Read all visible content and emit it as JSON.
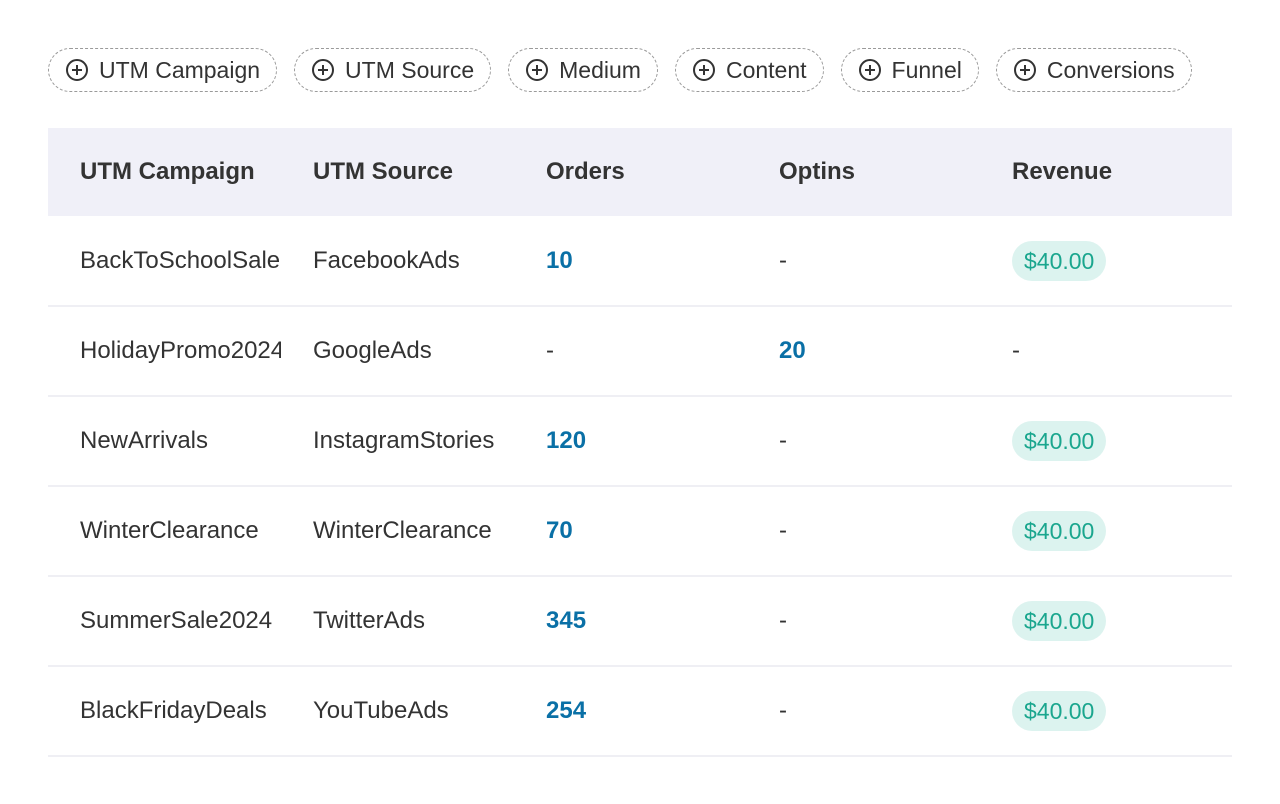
{
  "filters": [
    {
      "label": "UTM Campaign",
      "icon": "plus-circle-icon"
    },
    {
      "label": "UTM Source",
      "icon": "plus-circle-icon"
    },
    {
      "label": "Medium",
      "icon": "plus-circle-icon"
    },
    {
      "label": "Content",
      "icon": "plus-circle-icon"
    },
    {
      "label": "Funnel",
      "icon": "plus-circle-icon"
    },
    {
      "label": "Conversions",
      "icon": "plus-circle-icon"
    }
  ],
  "table": {
    "headers": [
      "UTM Campaign",
      "UTM Source",
      "Orders",
      "Optins",
      "Revenue"
    ],
    "rows": [
      {
        "campaign": "BackToSchoolSale",
        "source": "FacebookAds",
        "orders": "10",
        "optins": "-",
        "revenue": "$40.00"
      },
      {
        "campaign": "HolidayPromo2024",
        "source": "GoogleAds",
        "orders": "-",
        "optins": "20",
        "revenue": "-"
      },
      {
        "campaign": "NewArrivals",
        "source": "InstagramStories",
        "orders": "120",
        "optins": "-",
        "revenue": "$40.00"
      },
      {
        "campaign": "WinterClearance",
        "source": "WinterClearance",
        "orders": "70",
        "optins": "-",
        "revenue": "$40.00"
      },
      {
        "campaign": "SummerSale2024",
        "source": "TwitterAds",
        "orders": "345",
        "optins": "-",
        "revenue": "$40.00"
      },
      {
        "campaign": "BlackFridayDeals",
        "source": "YouTubeAds",
        "orders": "254",
        "optins": "-",
        "revenue": "$40.00"
      }
    ]
  },
  "colors": {
    "link_number": "#0a70a6",
    "revenue_badge_text": "#1aa68e",
    "revenue_badge_bg": "#dcf3ef",
    "header_bg": "#f0f0f8"
  }
}
